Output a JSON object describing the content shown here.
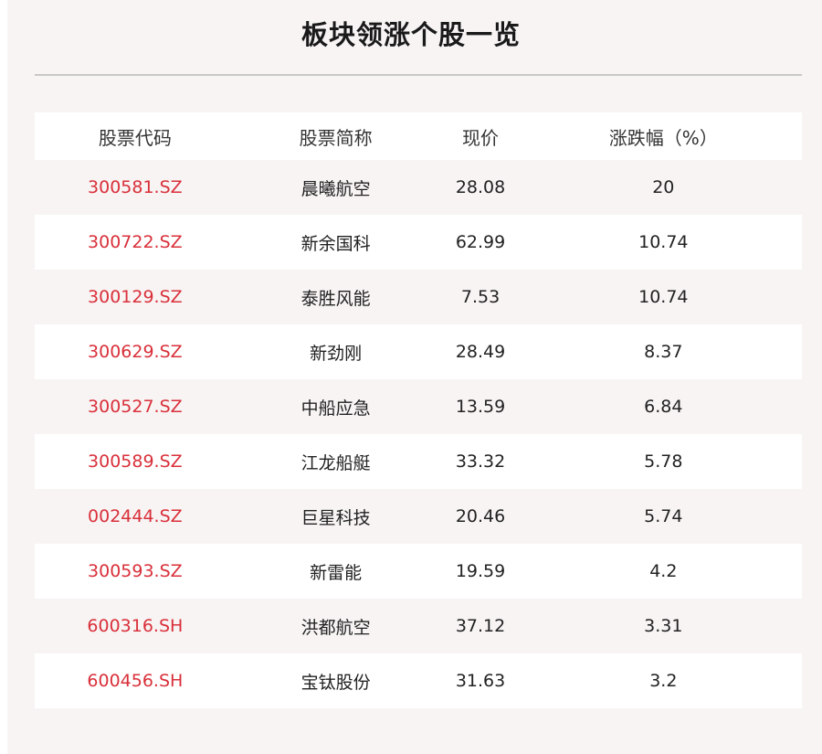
{
  "title": "板块领涨个股一览",
  "header": {
    "code": "股票代码",
    "name": "股票简称",
    "price": "现价",
    "change": "涨跌幅（%）"
  },
  "rows": [
    {
      "code": "300581.SZ",
      "name": "晨曦航空",
      "price": "28.08",
      "change": "20"
    },
    {
      "code": "300722.SZ",
      "name": "新余国科",
      "price": "62.99",
      "change": "10.74"
    },
    {
      "code": "300129.SZ",
      "name": "泰胜风能",
      "price": "7.53",
      "change": "10.74"
    },
    {
      "code": "300629.SZ",
      "name": "新劲刚",
      "price": "28.49",
      "change": "8.37"
    },
    {
      "code": "300527.SZ",
      "name": "中船应急",
      "price": "13.59",
      "change": "6.84"
    },
    {
      "code": "300589.SZ",
      "name": "江龙船艇",
      "price": "33.32",
      "change": "5.78"
    },
    {
      "code": "002444.SZ",
      "name": "巨星科技",
      "price": "20.46",
      "change": "5.74"
    },
    {
      "code": "300593.SZ",
      "name": "新雷能",
      "price": "19.59",
      "change": "4.2"
    },
    {
      "code": "600316.SH",
      "name": "洪都航空",
      "price": "37.12",
      "change": "3.31"
    },
    {
      "code": "600456.SH",
      "name": "宝钛股份",
      "price": "31.63",
      "change": "3.2"
    }
  ],
  "colors": {
    "code_text": "#d9303a",
    "background": "#f8f4f4",
    "row_alt": "#ffffff"
  }
}
